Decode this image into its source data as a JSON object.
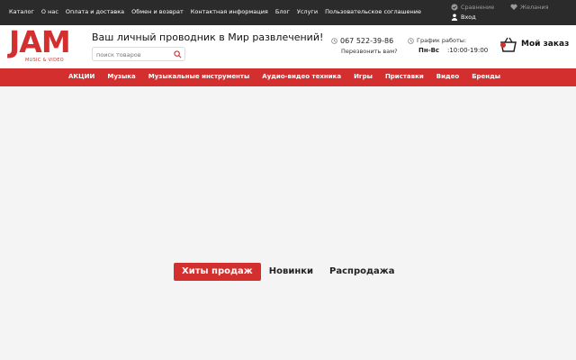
{
  "topbar": {
    "links": [
      "Каталог",
      "О нас",
      "Оплата и доставка",
      "Обмен и возврат",
      "Контактная информация",
      "Блог",
      "Услуги",
      "Пользовательское соглашение"
    ],
    "compare_label": "Сравнение",
    "wishlist_label": "Желания",
    "login_label": "Вход"
  },
  "header": {
    "logo_text": "JAM",
    "logo_sub": "MUSIC & VIDEO",
    "slogan": "Ваш личный проводник в Мир развлечений!",
    "search_placeholder": "поиск товаров",
    "phone": "067 522-39-86",
    "callback": "Перезвонить вам?",
    "schedule_label": "График работы:",
    "schedule_days": "Пн-Вс",
    "schedule_time": ":10:00-19:00",
    "cart_label": "Мой заказ"
  },
  "nav": {
    "items": [
      "АКЦИИ",
      "Музыка",
      "Музыкальные инструменты",
      "Аудио-видео техника",
      "Игры",
      "Приставки",
      "Видео",
      "Бренды"
    ]
  },
  "tabs": {
    "items": [
      "Хиты продаж",
      "Новинки",
      "Распродажа"
    ],
    "active_index": 0
  },
  "colors": {
    "accent": "#d32f2f",
    "topbar_bg": "#2b2b2b",
    "page_bg": "#f4f4f4"
  }
}
